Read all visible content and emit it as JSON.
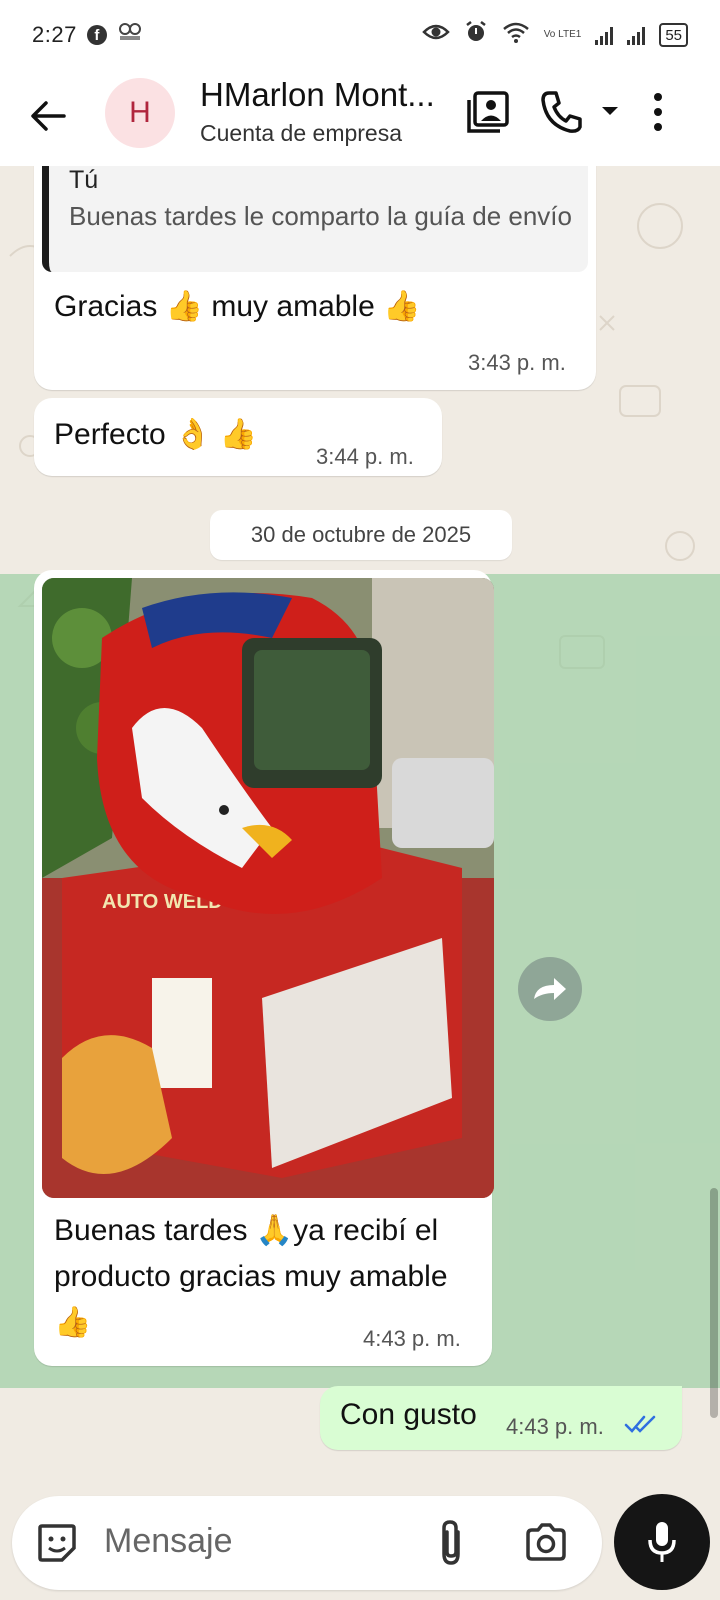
{
  "status_bar": {
    "time": "2:27",
    "network_label": "Vo LTE1",
    "battery": "55"
  },
  "header": {
    "avatar_letter": "H",
    "contact_name": "HMarlon Mont...",
    "subtitle": "Cuenta de empresa"
  },
  "messages": {
    "quote_author": "Tú",
    "quote_text": "Buenas tardes le comparto la guía de envío",
    "msg1_text": "Gracias 👍 muy amable 👍",
    "msg1_time": "3:43 p. m.",
    "msg2_text": "Perfecto 👌 👍",
    "msg2_time": "3:44 p. m.",
    "date_separator": "30 de octubre de 2025",
    "photo_caption": "Buenas tardes 🙏ya recibí el producto gracias muy amable 👍",
    "photo_time": "4:43 p. m.",
    "photo_box_text": "AUTO WELD",
    "out_text": "Con gusto",
    "out_time": "4:43 p. m."
  },
  "input": {
    "placeholder": "Mensaje"
  },
  "colors": {
    "outgoing_bubble": "#d9fdd3",
    "selected_highlight": "#96cda0",
    "read_ticks": "#2f6fe0",
    "avatar_bg": "#fbe1e3",
    "avatar_fg": "#b0253d"
  }
}
